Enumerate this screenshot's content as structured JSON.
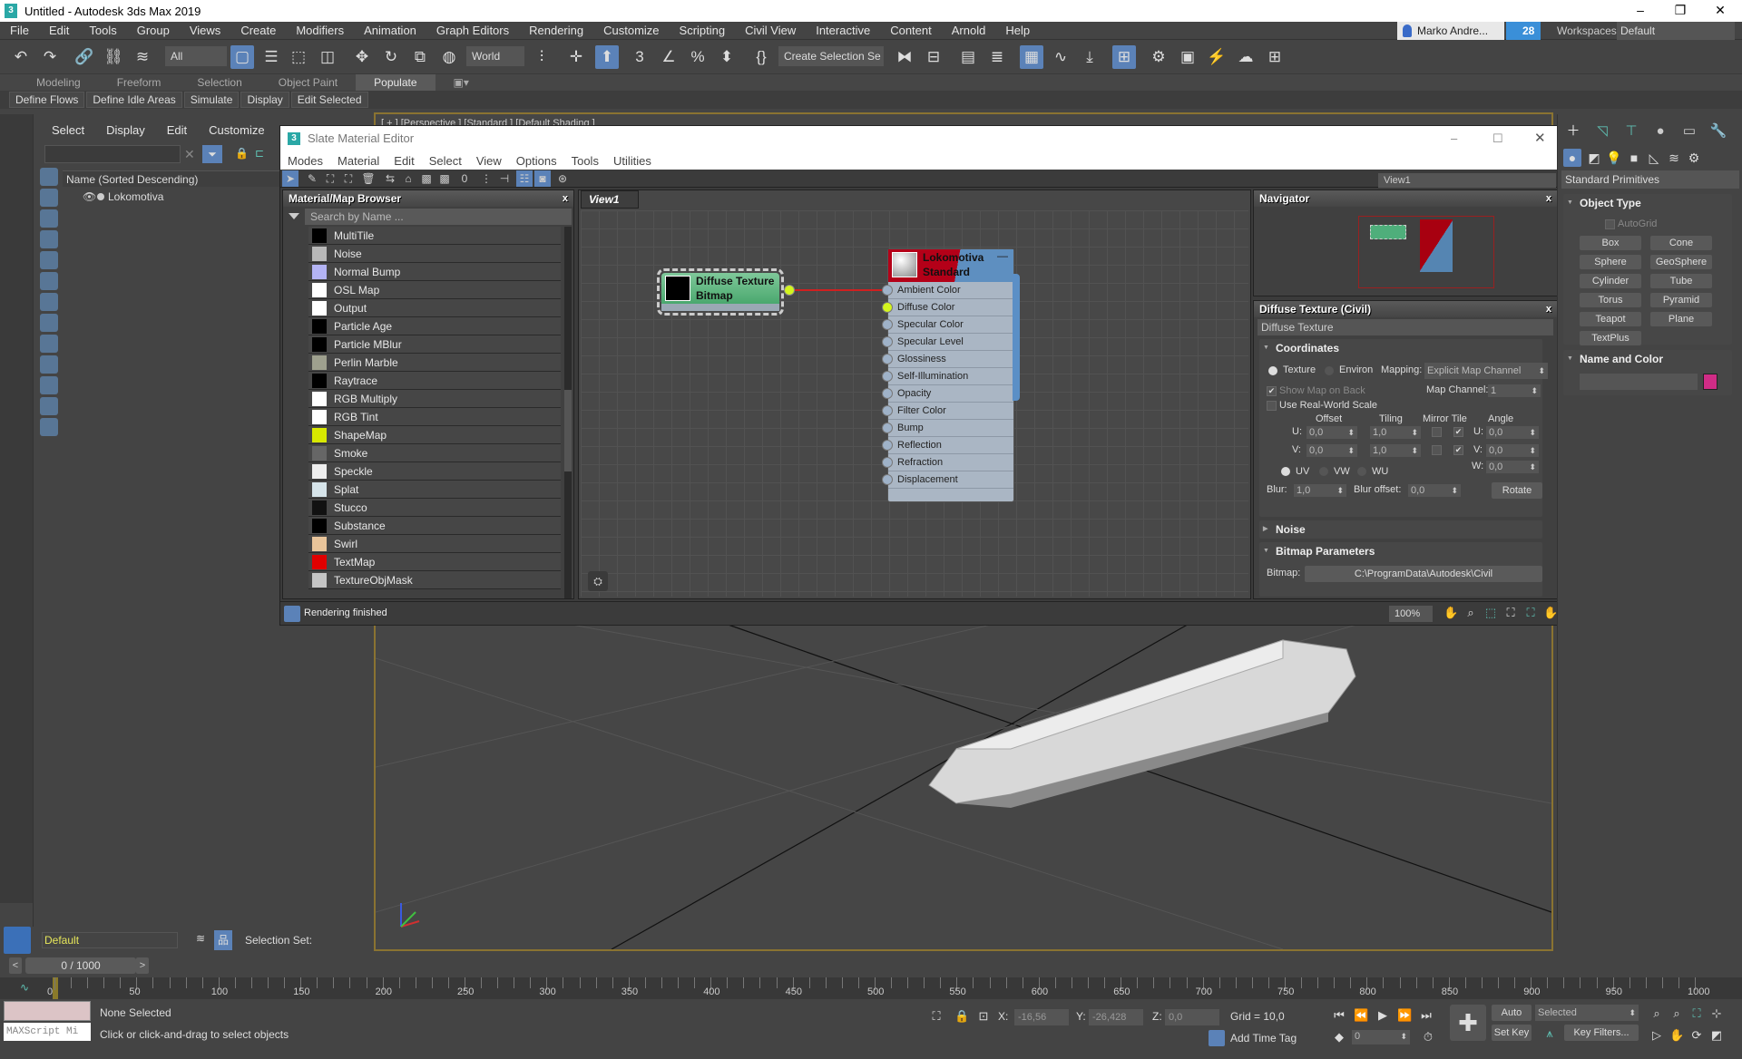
{
  "window": {
    "title": "Untitled - Autodesk 3ds Max 2019",
    "logo": "3",
    "minimize": "–",
    "maximize": "❐",
    "close": "✕"
  },
  "menu": [
    "File",
    "Edit",
    "Tools",
    "Group",
    "Views",
    "Create",
    "Modifiers",
    "Animation",
    "Graph Editors",
    "Rendering",
    "Customize",
    "Scripting",
    "Civil View",
    "Interactive",
    "Content",
    "Arnold",
    "Help"
  ],
  "account": {
    "user": "Marko Andre...",
    "notifications": "28",
    "workspaces_label": "Workspaces:",
    "workspace": "Default"
  },
  "toolbar": {
    "filter": "All",
    "ref_coord": "World",
    "selection_set": "Create Selection Se"
  },
  "ribbon": {
    "tabs": [
      "Modeling",
      "Freeform",
      "Selection",
      "Object Paint",
      "Populate"
    ],
    "active": "Populate"
  },
  "populate": [
    "Define Flows",
    "Define Idle Areas",
    "Simulate",
    "Display",
    "Edit Selected"
  ],
  "scene_explorer": {
    "menu": [
      "Select",
      "Display",
      "Edit",
      "Customize"
    ],
    "column": "Name (Sorted Descending)",
    "items": [
      "Lokomotiva"
    ]
  },
  "viewport": {
    "label": "[ + ] [Perspective ] [Standard ] [Default Shading ]"
  },
  "slate": {
    "title": "Slate Material Editor",
    "menu": [
      "Modes",
      "Material",
      "Edit",
      "Select",
      "View",
      "Options",
      "Tools",
      "Utilities"
    ],
    "browser": {
      "title": "Material/Map Browser",
      "search_placeholder": "Search by Name ...",
      "items": [
        {
          "name": "MultiTile",
          "swatch": "#000000"
        },
        {
          "name": "Noise",
          "swatch": "#b8b8b8"
        },
        {
          "name": "Normal Bump",
          "swatch": "#b4b4f4"
        },
        {
          "name": "OSL Map",
          "swatch": "#ffffff"
        },
        {
          "name": "Output",
          "swatch": "#ffffff"
        },
        {
          "name": "Particle Age",
          "swatch": "#000000"
        },
        {
          "name": "Particle MBlur",
          "swatch": "#000000"
        },
        {
          "name": "Perlin Marble",
          "swatch": "#9ea08e"
        },
        {
          "name": "Raytrace",
          "swatch": "#000000"
        },
        {
          "name": "RGB Multiply",
          "swatch": "#ffffff"
        },
        {
          "name": "RGB Tint",
          "swatch": "#ffffff"
        },
        {
          "name": "ShapeMap",
          "swatch": "#d8e800"
        },
        {
          "name": "Smoke",
          "swatch": "#666666"
        },
        {
          "name": "Speckle",
          "swatch": "#eeeeee"
        },
        {
          "name": "Splat",
          "swatch": "#d6e4ea"
        },
        {
          "name": "Stucco",
          "swatch": "#111111"
        },
        {
          "name": "Substance",
          "swatch": "#000000"
        },
        {
          "name": "Swirl",
          "swatch": "#e8c49a"
        },
        {
          "name": "TextMap",
          "swatch": "#e00000"
        },
        {
          "name": "TextureObjMask",
          "swatch": "#c4c4c4"
        }
      ]
    },
    "view_tab": "View1",
    "view_select": "View1",
    "bitmap_node": {
      "line1": "Diffuse Texture",
      "line2": "Bitmap"
    },
    "material_node": {
      "line1": "Lokomotiva",
      "line2": "Standard",
      "slots": [
        "Ambient Color",
        "Diffuse Color",
        "Specular Color",
        "Specular Level",
        "Glossiness",
        "Self-Illumination",
        "Opacity",
        "Filter Color",
        "Bump",
        "Reflection",
        "Refraction",
        "Displacement"
      ],
      "connected_slot": "Diffuse Color"
    },
    "navigator": {
      "title": "Navigator"
    },
    "params": {
      "title": "Diffuse Texture (Civil)",
      "name": "Diffuse Texture",
      "coordinates": {
        "title": "Coordinates",
        "texture": "Texture",
        "environ": "Environ",
        "mapping_label": "Mapping:",
        "mapping": "Explicit Map Channel",
        "show_map_on_back": "Show Map on Back",
        "map_channel_label": "Map Channel:",
        "map_channel": "1",
        "real_world": "Use Real-World Scale",
        "offset": "Offset",
        "tiling": "Tiling",
        "mirror_tile": "Mirror Tile",
        "angle": "Angle",
        "u": "U:",
        "v": "V:",
        "w": "W:",
        "offset_u": "0,0",
        "offset_v": "0,0",
        "tiling_u": "1,0",
        "tiling_v": "1,0",
        "angle_u": "0,0",
        "angle_v": "0,0",
        "angle_w": "0,0",
        "uv": "UV",
        "vw": "VW",
        "wu": "WU",
        "blur_label": "Blur:",
        "blur": "1,0",
        "blur_offset_label": "Blur offset:",
        "blur_offset": "0,0",
        "rotate": "Rotate"
      },
      "noise": "Noise",
      "bitmap_params": {
        "title": "Bitmap Parameters",
        "bitmap_label": "Bitmap:",
        "path": "C:\\ProgramData\\Autodesk\\Civil"
      }
    },
    "status": "Rendering finished",
    "zoom": "100%"
  },
  "command_panel": {
    "category": "Standard Primitives",
    "object_type": "Object Type",
    "autogrid": "AutoGrid",
    "primitives": [
      "Box",
      "Cone",
      "Sphere",
      "GeoSphere",
      "Cylinder",
      "Tube",
      "Torus",
      "Pyramid",
      "Teapot",
      "Plane",
      "TextPlus"
    ],
    "name_and_color": "Name and Color",
    "object_color": "#d02c86"
  },
  "layer": {
    "current": "Default",
    "selection_set_label": "Selection Set:"
  },
  "timeline": {
    "frame": "0 / 1000",
    "prev": "<",
    "next": ">",
    "labels": [
      "0",
      "50",
      "100",
      "150",
      "200",
      "250",
      "300",
      "350",
      "400",
      "450",
      "500",
      "550",
      "600",
      "650",
      "700",
      "750",
      "800",
      "850",
      "900",
      "950",
      "1000"
    ],
    "current_frame": "0"
  },
  "status": {
    "selection": "None Selected",
    "prompt": "Click or click-and-drag to select objects",
    "maxscript": "MAXScript Mi",
    "x_label": "X:",
    "x": "-16,56",
    "y_label": "Y:",
    "y": "-26,428",
    "z_label": "Z:",
    "z": "0,0",
    "grid": "Grid = 10,0",
    "add_time_tag": "Add Time Tag",
    "auto_key": "Auto Key",
    "set_key": "Set Key",
    "key_mode": "Selected",
    "key_filters": "Key Filters...",
    "frame_spinner": "0"
  }
}
